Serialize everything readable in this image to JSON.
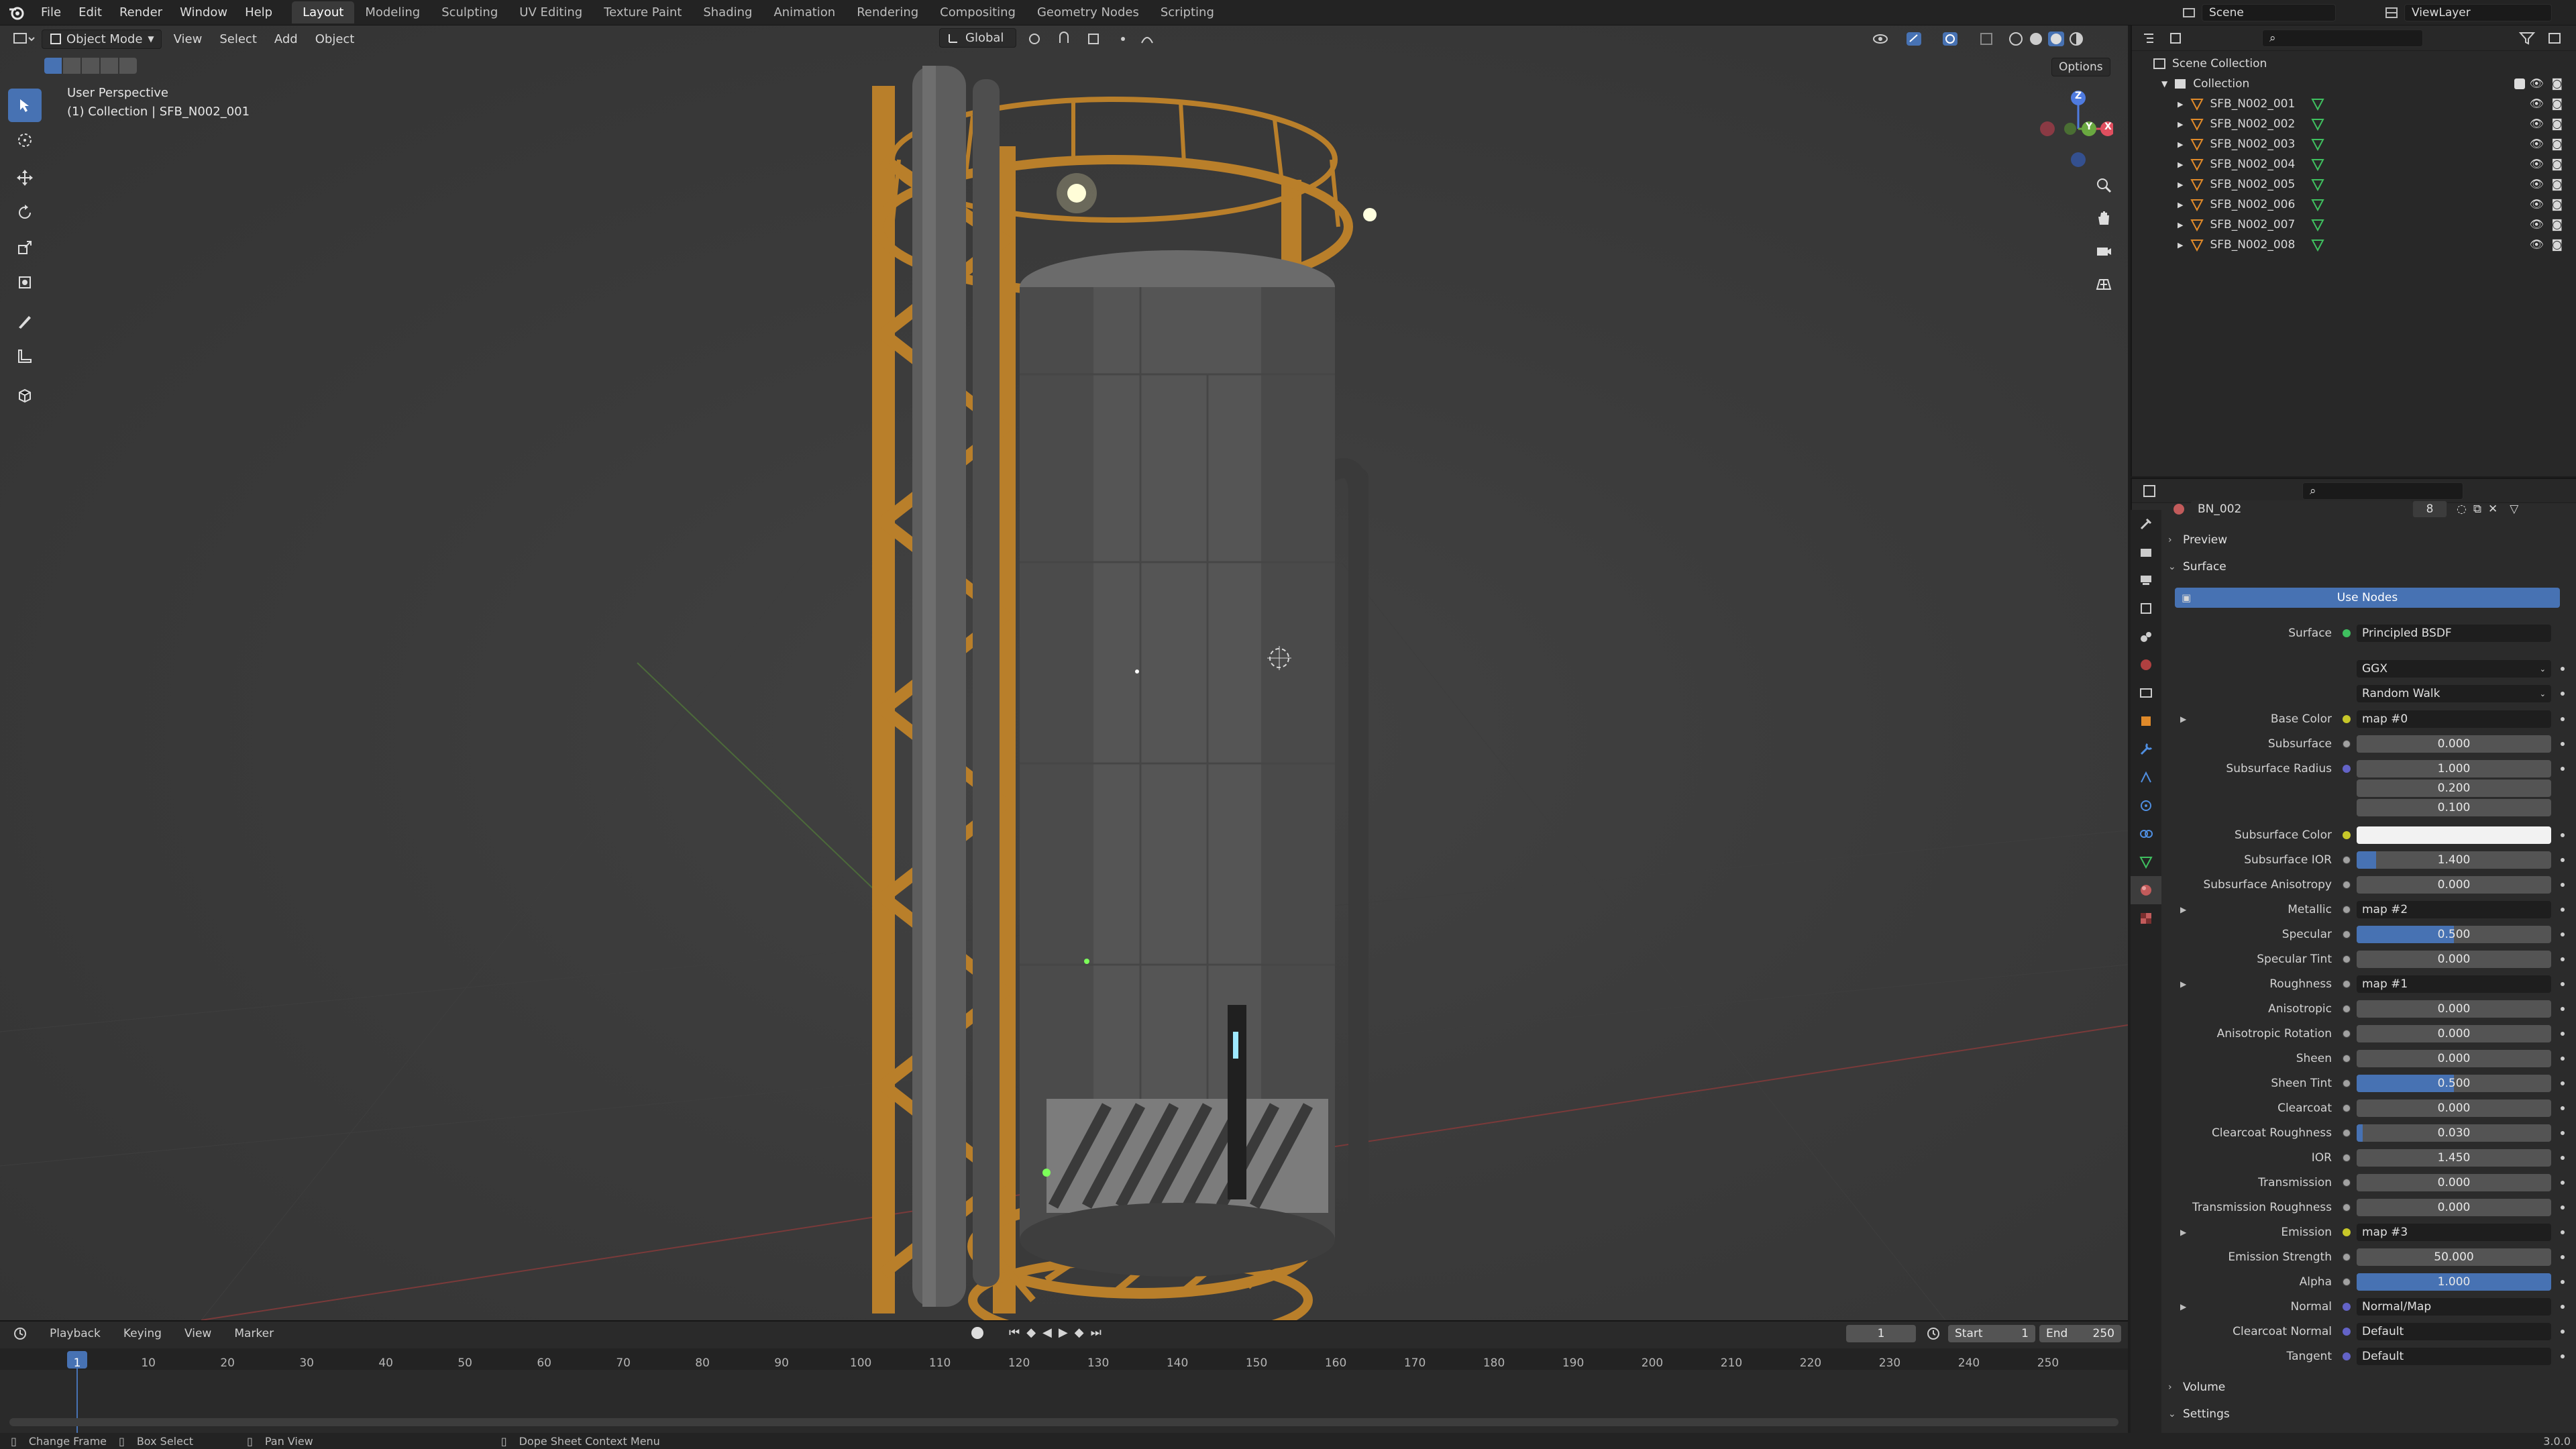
{
  "menu": [
    "File",
    "Edit",
    "Render",
    "Window",
    "Help"
  ],
  "workspaces": [
    "Layout",
    "Modeling",
    "Sculpting",
    "UV Editing",
    "Texture Paint",
    "Shading",
    "Animation",
    "Rendering",
    "Compositing",
    "Geometry Nodes",
    "Scripting"
  ],
  "scene": "Scene",
  "view_layer": "ViewLayer",
  "viewport": {
    "mode": "Object Mode",
    "menus": [
      "View",
      "Select",
      "Add",
      "Object"
    ],
    "orientation": "Global",
    "options": "Options",
    "perspective": "User Perspective",
    "active": "(1) Collection | SFB_N002_001",
    "gizmo": {
      "z": "Z",
      "y": "Y",
      "x": "X"
    }
  },
  "outliner": {
    "root": "Scene Collection",
    "collection": "Collection",
    "objects": [
      "SFB_N002_001",
      "SFB_N002_002",
      "SFB_N002_003",
      "SFB_N002_004",
      "SFB_N002_005",
      "SFB_N002_006",
      "SFB_N002_007",
      "SFB_N002_008"
    ]
  },
  "properties": {
    "material_name": "BN_002",
    "users": "8",
    "sections": {
      "preview": "Preview",
      "surface": "Surface",
      "volume": "Volume",
      "settings": "Settings"
    },
    "use_nodes": "Use Nodes",
    "surface_label": "Surface",
    "surface_value": "Principled BSDF",
    "distribution": "GGX",
    "subsurface_method": "Random Walk",
    "rows": [
      {
        "label": "Base Color",
        "kind": "link",
        "value": "map #0",
        "socket": "yellow",
        "expand": true
      },
      {
        "label": "Subsurface",
        "kind": "num",
        "value": "0.000",
        "socket": "gray"
      },
      {
        "label": "Subsurface Radius",
        "kind": "num",
        "value": "1.000",
        "socket": "purple"
      },
      {
        "label": "",
        "kind": "num",
        "value": "0.200",
        "socket": "none"
      },
      {
        "label": "",
        "kind": "num",
        "value": "0.100",
        "socket": "none"
      },
      {
        "label": "Subsurface Color",
        "kind": "color",
        "value": "",
        "socket": "yellow"
      },
      {
        "label": "Subsurface IOR",
        "kind": "num",
        "value": "1.400",
        "socket": "gray",
        "fill": 0.1
      },
      {
        "label": "Subsurface Anisotropy",
        "kind": "num",
        "value": "0.000",
        "socket": "gray"
      },
      {
        "label": "Metallic",
        "kind": "link",
        "value": "map #2",
        "socket": "gray",
        "expand": true
      },
      {
        "label": "Specular",
        "kind": "num",
        "value": "0.500",
        "socket": "gray",
        "fill": 0.5
      },
      {
        "label": "Specular Tint",
        "kind": "num",
        "value": "0.000",
        "socket": "gray"
      },
      {
        "label": "Roughness",
        "kind": "link",
        "value": "map #1",
        "socket": "gray",
        "expand": true
      },
      {
        "label": "Anisotropic",
        "kind": "num",
        "value": "0.000",
        "socket": "gray"
      },
      {
        "label": "Anisotropic Rotation",
        "kind": "num",
        "value": "0.000",
        "socket": "gray"
      },
      {
        "label": "Sheen",
        "kind": "num",
        "value": "0.000",
        "socket": "gray"
      },
      {
        "label": "Sheen Tint",
        "kind": "num",
        "value": "0.500",
        "socket": "gray",
        "fill": 0.5
      },
      {
        "label": "Clearcoat",
        "kind": "num",
        "value": "0.000",
        "socket": "gray"
      },
      {
        "label": "Clearcoat Roughness",
        "kind": "num",
        "value": "0.030",
        "socket": "gray",
        "fill": 0.03
      },
      {
        "label": "IOR",
        "kind": "num",
        "value": "1.450",
        "socket": "gray"
      },
      {
        "label": "Transmission",
        "kind": "num",
        "value": "0.000",
        "socket": "gray"
      },
      {
        "label": "Transmission Roughness",
        "kind": "num",
        "value": "0.000",
        "socket": "gray"
      },
      {
        "label": "Emission",
        "kind": "link",
        "value": "map #3",
        "socket": "yellow",
        "expand": true
      },
      {
        "label": "Emission Strength",
        "kind": "num",
        "value": "50.000",
        "socket": "gray"
      },
      {
        "label": "Alpha",
        "kind": "num",
        "value": "1.000",
        "socket": "gray",
        "fill": 1.0
      },
      {
        "label": "Normal",
        "kind": "link",
        "value": "Normal/Map",
        "socket": "purple",
        "expand": true
      },
      {
        "label": "Clearcoat Normal",
        "kind": "link",
        "value": "Default",
        "socket": "purple"
      },
      {
        "label": "Tangent",
        "kind": "link",
        "value": "Default",
        "socket": "purple"
      }
    ]
  },
  "timeline": {
    "menus": [
      "Playback",
      "Keying",
      "View",
      "Marker"
    ],
    "current_frame": "1",
    "start_label": "Start",
    "start": "1",
    "end_label": "End",
    "end": "250",
    "ticks": [
      "1",
      "10",
      "20",
      "30",
      "40",
      "50",
      "60",
      "70",
      "80",
      "90",
      "100",
      "110",
      "120",
      "130",
      "140",
      "150",
      "160",
      "170",
      "180",
      "190",
      "200",
      "210",
      "220",
      "230",
      "240",
      "250"
    ]
  },
  "statusbar": {
    "left": [
      "Change Frame",
      "Box Select",
      "Pan View",
      "Dope Sheet Context Menu"
    ],
    "version": "3.0.0"
  }
}
